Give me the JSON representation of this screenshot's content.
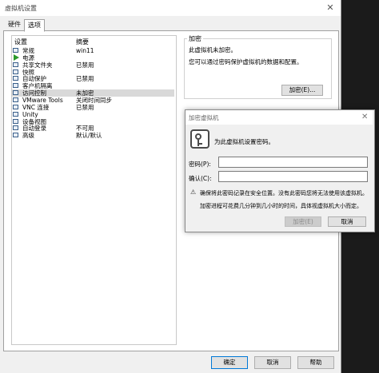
{
  "window": {
    "title": "虚拟机设置",
    "close_glyph": "✕"
  },
  "tabs": [
    {
      "label": "硬件"
    },
    {
      "label": "选项"
    }
  ],
  "list": {
    "headers": {
      "setting": "设置",
      "summary": "摘要"
    },
    "items": [
      {
        "name": "常规",
        "summary": "win11",
        "icon": "monitor-icon"
      },
      {
        "name": "电源",
        "summary": "",
        "icon": "play-icon"
      },
      {
        "name": "共享文件夹",
        "summary": "已禁用",
        "icon": "folder-icon"
      },
      {
        "name": "快照",
        "summary": "",
        "icon": "snapshot-icon"
      },
      {
        "name": "自动保护",
        "summary": "已禁用",
        "icon": "clock-icon"
      },
      {
        "name": "客户机隔离",
        "summary": "",
        "icon": "isolation-icon"
      },
      {
        "name": "访问控制",
        "summary": "未加密",
        "icon": "lock-icon"
      },
      {
        "name": "VMware Tools",
        "summary": "关闭时间同步",
        "icon": "tools-icon"
      },
      {
        "name": "VNC 连接",
        "summary": "已禁用",
        "icon": "vnc-icon"
      },
      {
        "name": "Unity",
        "summary": "",
        "icon": "unity-icon"
      },
      {
        "name": "设备视图",
        "summary": "",
        "icon": "device-icon"
      },
      {
        "name": "自动登录",
        "summary": "不可用",
        "icon": "login-icon"
      },
      {
        "name": "高级",
        "summary": "默认/默认",
        "icon": "advanced-icon"
      }
    ],
    "selected_index": 6
  },
  "encryption": {
    "group_title": "加密",
    "status": "此虚拟机未加密。",
    "description": "您可以通过密码保护虚拟机的数据和配置。",
    "button": "加密(E)..."
  },
  "footer": {
    "ok": "确定",
    "cancel": "取消",
    "help": "帮助"
  },
  "encrypt_dialog": {
    "title": "加密虚拟机",
    "close_glyph": "✕",
    "heading": "为此虚拟机设置密码。",
    "password_label": "密码(P):",
    "password_value": "",
    "confirm_label": "确认(C):",
    "confirm_value": "",
    "warning_glyph": "⚠",
    "warning": "确保将此密码记录在安全位置。没有此密码您将无法使用该虚拟机。",
    "info": "加密进程可花费几分钟到几小时的时间，具体视虚拟机大小而定。",
    "encrypt_button": "加密(E)",
    "cancel_button": "取消"
  }
}
